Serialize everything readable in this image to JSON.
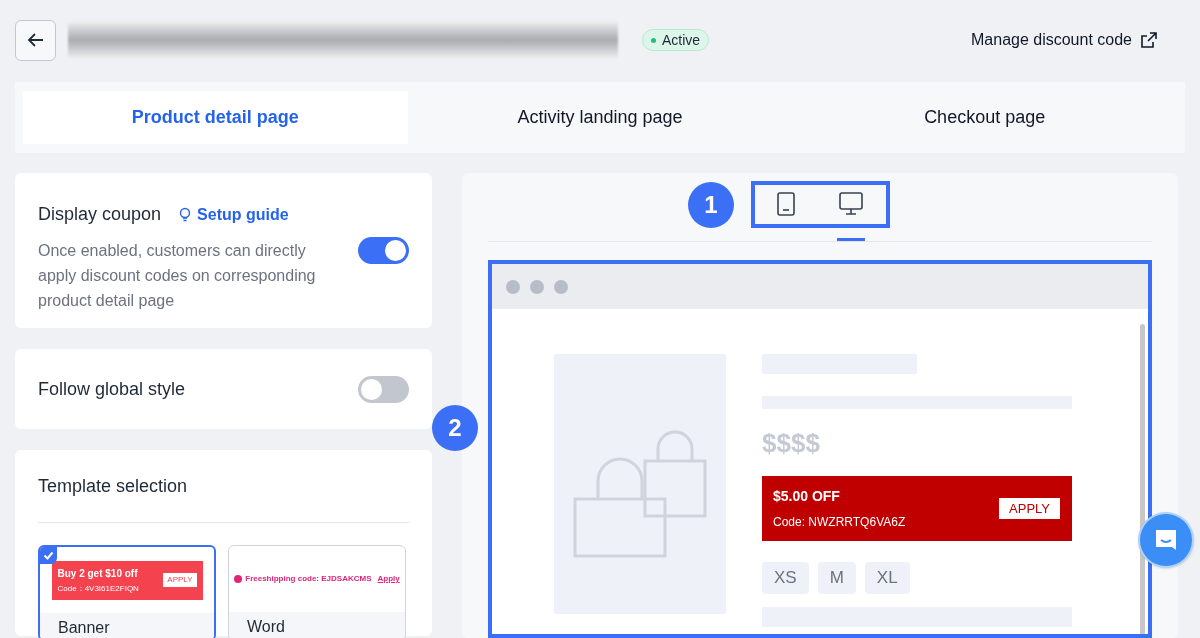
{
  "header": {
    "status": "Active",
    "manage_link": "Manage discount code"
  },
  "tabs": [
    {
      "label": "Product detail page",
      "selected": true
    },
    {
      "label": "Activity landing page",
      "selected": false
    },
    {
      "label": "Checkout page",
      "selected": false
    }
  ],
  "display_coupon": {
    "title": "Display coupon",
    "guide_link": "Setup guide",
    "description": "Once enabled, customers can directly apply discount codes on corresponding product detail page",
    "on": true
  },
  "follow_global_style": {
    "title": "Follow global style",
    "on": false
  },
  "template_selection": {
    "title": "Template selection",
    "templates": [
      {
        "kind": "banner",
        "name": "Banner",
        "selected": true,
        "offer": "Buy 2 get $10 off",
        "code": "Code：4V3I61E2FIQN",
        "button": "APPLY"
      },
      {
        "kind": "word",
        "name": "Word",
        "selected": false,
        "offer": "Freeshipping code: EJDSAKCMS",
        "button": "Apply"
      }
    ]
  },
  "preview": {
    "callouts": [
      "1",
      "2"
    ],
    "devices": [
      {
        "kind": "mobile",
        "selected": false
      },
      {
        "kind": "desktop",
        "selected": true
      }
    ],
    "price": "$$$$",
    "coupon": {
      "title": "$5.00 OFF",
      "code": "Code: NWZRRTQ6VA6Z",
      "button": "APPLY"
    },
    "sizes": [
      "XS",
      "M",
      "XL"
    ]
  }
}
